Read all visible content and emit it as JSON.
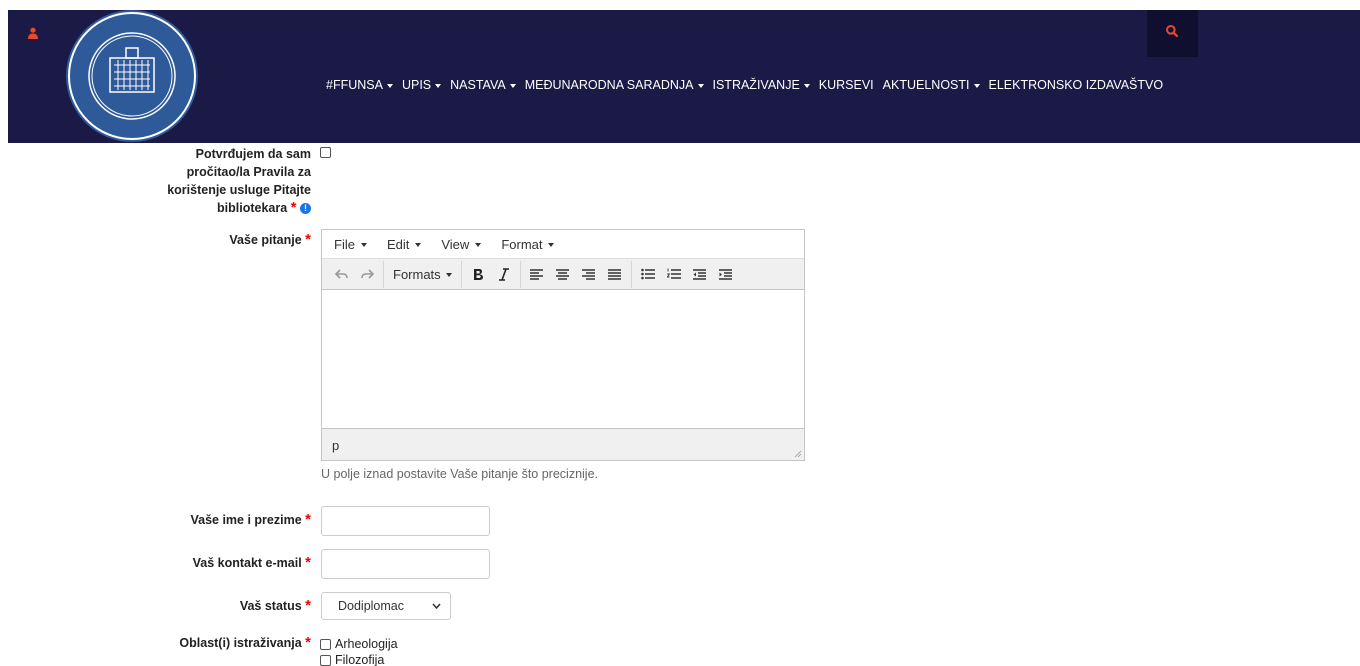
{
  "header": {
    "logo_alt": "Universitas Studiorum Sarajevoensis Filozofski Fakultet",
    "nav": [
      {
        "label": "#FFUNSA",
        "dropdown": true
      },
      {
        "label": "UPIS",
        "dropdown": true
      },
      {
        "label": "NASTAVA",
        "dropdown": true
      },
      {
        "label": "MEĐUNARODNA SARADNJA",
        "dropdown": true
      },
      {
        "label": "ISTRAŽIVANJE",
        "dropdown": true
      },
      {
        "label": "KURSEVI",
        "dropdown": false
      },
      {
        "label": "AKTUELNOSTI",
        "dropdown": true
      },
      {
        "label": "ELEKTRONSKO IZDAVAŠTVO",
        "dropdown": false
      }
    ],
    "icons": {
      "user": "user-icon",
      "search": "search-icon"
    },
    "colors": {
      "background": "#1b1a47",
      "search_bg": "#100f2f",
      "accent": "#e8482c"
    }
  },
  "form": {
    "confirm_label": "Potvrđujem da sam pročitao/la Pravila za korištenje usluge Pitajte bibliotekara",
    "question_label": "Vaše pitanje",
    "editor": {
      "menus": [
        "File",
        "Edit",
        "View",
        "Format"
      ],
      "formats_label": "Formats",
      "path": "p"
    },
    "help_text": "U polje iznad postavite Vaše pitanje što preciznije.",
    "name_label": "Vaše ime i prezime",
    "email_label": "Vaš kontakt e-mail",
    "status_label": "Vaš status",
    "status_value": "Dodiplomac",
    "areas_label": "Oblast(i) istraživanja",
    "areas": [
      "Arheologija",
      "Filozofija"
    ],
    "required_mark": "*"
  }
}
